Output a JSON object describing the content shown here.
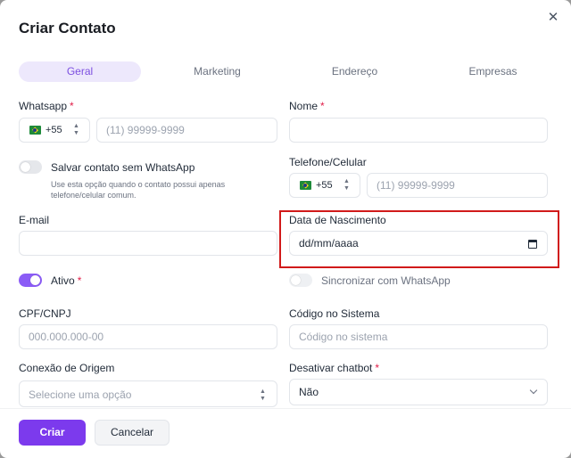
{
  "modal": {
    "title": "Criar Contato",
    "close": "✕"
  },
  "tabs": [
    {
      "label": "Geral"
    },
    {
      "label": "Marketing"
    },
    {
      "label": "Endereço"
    },
    {
      "label": "Empresas"
    }
  ],
  "form": {
    "whatsapp": {
      "label": "Whatsapp",
      "required": "*",
      "country_code": "+55",
      "placeholder": "(11) 99999-9999"
    },
    "nome": {
      "label": "Nome",
      "required": "*",
      "value": ""
    },
    "salvar_sem_whatsapp": {
      "label": "Salvar contato sem WhatsApp",
      "help_line1": "Use esta opção quando o contato possui apenas",
      "help_line2": "telefone/celular comum.",
      "checked": false
    },
    "telefone": {
      "label": "Telefone/Celular",
      "country_code": "+55",
      "placeholder": "(11) 99999-9999"
    },
    "email": {
      "label": "E-mail",
      "value": ""
    },
    "data_nascimento": {
      "label": "Data de Nascimento",
      "placeholder": "dd/mm/aaaa"
    },
    "ativo": {
      "label": "Ativo",
      "required": "*",
      "checked": true
    },
    "sincronizar": {
      "label": "Sincronizar com WhatsApp",
      "checked": false
    },
    "cpf": {
      "label": "CPF/CNPJ",
      "placeholder": "000.000.000-00"
    },
    "codigo": {
      "label": "Código no Sistema",
      "placeholder": "Código no sistema"
    },
    "conexao": {
      "label": "Conexão de Origem",
      "placeholder": "Selecione uma opção"
    },
    "chatbot": {
      "label": "Desativar chatbot",
      "required": "*",
      "value": "Não"
    }
  },
  "footer": {
    "create_label": "Criar",
    "cancel_label": "Cancelar"
  },
  "colors": {
    "accent": "#7c3aed",
    "highlight": "#d11a1a",
    "required": "#e11d48"
  }
}
